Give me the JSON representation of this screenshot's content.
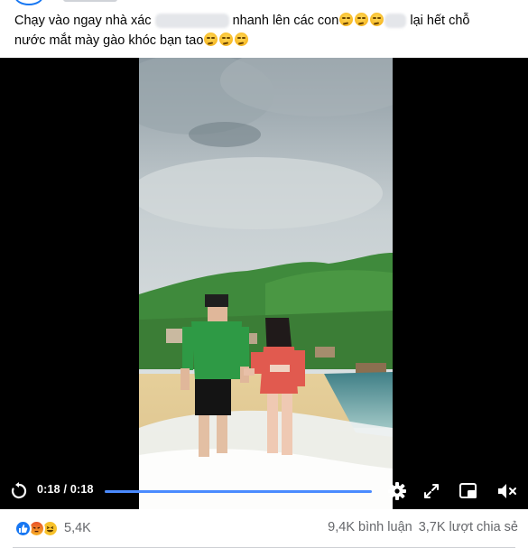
{
  "post": {
    "caption": {
      "part1": "Chạy vào ngay nhà xác",
      "part2": "nhanh lên các con",
      "part3": "lại hết chỗ",
      "part4": "nước mắt mày gào khóc bạn tao"
    },
    "emoji_name": "smirking-face"
  },
  "video": {
    "time_display": "0:18 / 0:18",
    "progress_fraction": 1.0,
    "progress_color": "#4b8bff",
    "icons": [
      "replay-icon",
      "settings-icon",
      "fullscreen-icon",
      "picture-in-picture-icon",
      "volume-muted-icon"
    ]
  },
  "footer": {
    "reactions": [
      "like",
      "angry",
      "haha"
    ],
    "reaction_count": "5,4K",
    "comments": "9,4K bình luận",
    "shares": "3,7K lượt chia sẻ"
  },
  "colors": {
    "accent": "#1877f2",
    "secondary_text": "#65676b"
  }
}
